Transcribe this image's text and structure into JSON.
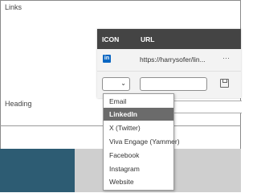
{
  "section": {
    "links_title": "Links",
    "heading_label": "Heading"
  },
  "table": {
    "columns": {
      "icon": "ICON",
      "url": "URL"
    },
    "rows": [
      {
        "icon": "linkedin-icon",
        "url": "https://harrysofer/lin..."
      }
    ],
    "more_glyph": "···"
  },
  "new_row": {
    "icon_select_value": "",
    "url_value": ""
  },
  "dropdown": {
    "options": [
      "Email",
      "LinkedIn",
      "X (Twitter)",
      "Viva Engage (Yammer)",
      "Facebook",
      "Instagram",
      "Website"
    ],
    "selected": "LinkedIn"
  },
  "colors": {
    "header_bg": "#444444",
    "linkedin_blue": "#0a66c2",
    "selected_bg": "#6b6b6b",
    "bottom_dark": "#2d5c73"
  }
}
